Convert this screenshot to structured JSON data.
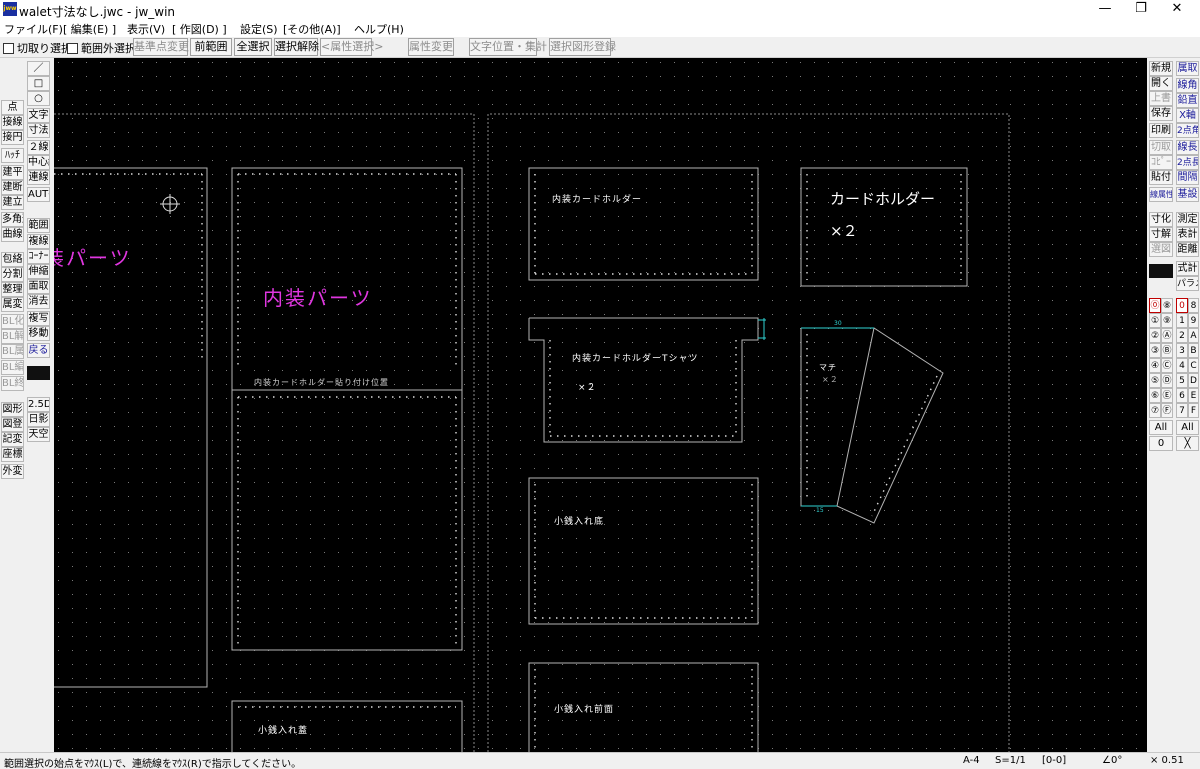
{
  "window": {
    "title": "walet寸法なし.jwc - jw_win",
    "icon_text": "jww",
    "minimize": "—",
    "maximize": "❐",
    "close": "✕"
  },
  "menu": [
    "ファイル(F)",
    "[ 編集(E) ]",
    "表示(V)",
    "[ 作図(D) ]",
    "設定(S)",
    "[その他(A)]",
    "ヘルプ(H)"
  ],
  "toolbar": {
    "chk_cut": "切取り選択",
    "chk_outside": "範囲外選択",
    "btn_base": "基準点変更",
    "btn_prev": "前範囲",
    "btn_all": "全選択",
    "btn_release": "選択解除",
    "btn_attr_sel": "<属性選択>",
    "btn_attr_change": "属性変更",
    "btn_text_pos": "文字位置・集計",
    "btn_register": "選択図形登録"
  },
  "left_tools": {
    "col1": [
      "点",
      "接線",
      "接円",
      "ﾊｯﾁ",
      "建平",
      "建断",
      "建立",
      "多角形",
      "曲線",
      "包絡",
      "分割",
      "整理",
      "属変",
      "BL化",
      "BL解",
      "BL属",
      "BL編",
      "BL終",
      "図形",
      "図登",
      "記変",
      "座標",
      "外変"
    ],
    "col2": [
      "／",
      "□",
      "○",
      "文字",
      "寸法",
      "２線",
      "中心線",
      "連線",
      "AUTO",
      "範囲",
      "複線",
      "ｺｰﾅｰ",
      "伸縮",
      "面取",
      "消去",
      "複写",
      "移動",
      "戻る",
      "2.5D",
      "日影",
      "天空"
    ]
  },
  "right_tools": {
    "col1": [
      "新規",
      "開く",
      "上書",
      "保存",
      "印刷",
      "切取",
      "ｺﾋﾟｰ",
      "貼付",
      "線属性",
      "寸化",
      "寸解",
      "選図"
    ],
    "col2": [
      "属取",
      "線角",
      "鉛直",
      "X軸",
      "2点角",
      "線長",
      "2点長",
      "間隔",
      "基設",
      "測定",
      "表計",
      "距離",
      "式計",
      "パラメ"
    ],
    "layers_a": [
      "⓪",
      "①",
      "②",
      "③",
      "④",
      "⑤",
      "⑥",
      "⑦"
    ],
    "layers_b": [
      "⑧",
      "⑨",
      "Ⓐ",
      "Ⓑ",
      "Ⓒ",
      "Ⓓ",
      "Ⓔ",
      "Ⓕ"
    ],
    "groups_a": [
      "0",
      "1",
      "2",
      "3",
      "4",
      "5",
      "6",
      "7"
    ],
    "groups_b": [
      "8",
      "9",
      "A",
      "B",
      "C",
      "D",
      "E",
      "F"
    ],
    "all_label": "All",
    "zero_label": "0",
    "x_label": "╳"
  },
  "drawing": {
    "parts_label": "内装パーツ",
    "parts_label_left": "装パーツ",
    "card_holder": "内装カードホルダー",
    "card_holder_big": "カードホルダー",
    "times2": "×２",
    "times2_big": "×２",
    "card_tshirt": "内装カードホルダーTシャツ",
    "times2_b": "×２",
    "paste_pos": "内装カードホルダー貼り付け位置",
    "gusset": "マチ",
    "gusset_qty": "×２",
    "dim30": "30",
    "dim15": "15",
    "coin_bottom": "小銭入れ底",
    "coin_front": "小銭入れ前面",
    "coin_lid": "小銭入れ蓋"
  },
  "status": {
    "message": "範囲選択の始点をﾏｳｽ(L)で、連続線をﾏｳｽ(R)で指示してください。",
    "paper": "A-4",
    "scale": "S=1/1",
    "layer": "[0-0]",
    "angle": "∠0°",
    "zoom": "× 0.51"
  }
}
